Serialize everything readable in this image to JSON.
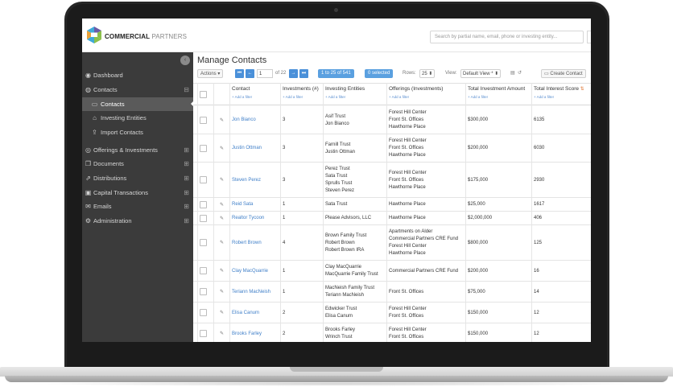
{
  "brand": {
    "name_bold": "COMMERCIAL",
    "name_light": "PARTNERS",
    "colors": [
      "#e8a23a",
      "#3fa9d9",
      "#8cc04b",
      "#6b5ba8"
    ]
  },
  "search": {
    "placeholder": "Search by partial name, email, phone or investing entity..."
  },
  "sidebar": {
    "collapse_icon": "chevron-left-icon",
    "items": [
      {
        "label": "Dashboard",
        "icon": "dashboard-icon",
        "expand": ""
      },
      {
        "label": "Contacts",
        "icon": "contacts-icon",
        "expand": "⊟"
      },
      {
        "label": "Contacts",
        "icon": "card-icon",
        "expand": "",
        "sub": true,
        "active": true
      },
      {
        "label": "Investing Entities",
        "icon": "bank-icon",
        "expand": "",
        "sub": true
      },
      {
        "label": "Import Contacts",
        "icon": "upload-icon",
        "expand": "",
        "sub": true
      },
      {
        "label": "Offerings & Investments",
        "icon": "coins-icon",
        "expand": "⊞"
      },
      {
        "label": "Documents",
        "icon": "documents-icon",
        "expand": "⊞"
      },
      {
        "label": "Distributions",
        "icon": "share-icon",
        "expand": "⊞"
      },
      {
        "label": "Capital Transactions",
        "icon": "money-icon",
        "expand": "⊞"
      },
      {
        "label": "Emails",
        "icon": "mail-icon",
        "expand": "⊞"
      },
      {
        "label": "Administration",
        "icon": "gears-icon",
        "expand": "⊞"
      }
    ]
  },
  "main": {
    "title": "Manage Contacts",
    "toolbar": {
      "actions": "Actions ▾",
      "page": "1",
      "of_pages": "of 22",
      "range": "1 to 25 of 541",
      "selected": "0 selected",
      "rows_label": "Rows:",
      "rows_value": "25 ⬍",
      "view_label": "View:",
      "view_value": "Default View * ⬍",
      "create": "Create Contact"
    },
    "add_filter": "+ Add a filter",
    "columns": [
      "Contact",
      "Investments (#)",
      "Investing Entities",
      "Offerings (Investments)",
      "Total Investment Amount",
      "Total Interest Score"
    ],
    "rows": [
      {
        "contact": "Jon Bianco",
        "investments": "3",
        "entities": [
          "Asif Trust",
          "Jon Bianco"
        ],
        "offerings": [
          "Forest Hill Center",
          "Front St. Offices",
          "Hawthorne Place"
        ],
        "amount": "$300,000",
        "score": "6135"
      },
      {
        "contact": "Justin Ottman",
        "investments": "3",
        "entities": [
          "Farnill Trust",
          "Justin Ottman"
        ],
        "offerings": [
          "Forest Hill Center",
          "Front St. Offices",
          "Hawthorne Place"
        ],
        "amount": "$200,000",
        "score": "6030"
      },
      {
        "contact": "Steven Perez",
        "investments": "3",
        "entities": [
          "Perez Trust",
          "Sata Trust",
          "Sprulls Trust",
          "Steven Perez"
        ],
        "offerings": [
          "Forest Hill Center",
          "Front St. Offices",
          "Hawthorne Place"
        ],
        "amount": "$175,000",
        "score": "2930"
      },
      {
        "contact": "Reid Sata",
        "investments": "1",
        "entities": [
          "Sata Trust"
        ],
        "offerings": [
          "Hawthorne Place"
        ],
        "amount": "$25,000",
        "score": "1617"
      },
      {
        "contact": "Realtor Tycoon",
        "investments": "1",
        "entities": [
          "Please Advisors, LLC"
        ],
        "offerings": [
          "Hawthorne Place"
        ],
        "amount": "$2,000,000",
        "score": "406"
      },
      {
        "contact": "Robert Brown",
        "investments": "4",
        "entities": [
          "Brown Family Trust",
          "Robert Brown",
          "Robert Brown IRA"
        ],
        "offerings": [
          "Apartments on Alder",
          "Commercial Partners CRE Fund",
          "Forest Hill Center",
          "Hawthorne Place"
        ],
        "amount": "$800,000",
        "score": "125"
      },
      {
        "contact": "Clay MacQuarrie",
        "investments": "1",
        "entities": [
          "Clay MacQuarrie",
          "MacQuarrie Family Trust"
        ],
        "offerings": [
          "Commercial Partners CRE Fund"
        ],
        "amount": "$200,000",
        "score": "16"
      },
      {
        "contact": "Teriann MacNeish",
        "investments": "1",
        "entities": [
          "MacNeish Family Trust",
          "Teriann MacNeish"
        ],
        "offerings": [
          "Front St. Offices"
        ],
        "amount": "$75,000",
        "score": "14"
      },
      {
        "contact": "Elisa Canum",
        "investments": "2",
        "entities": [
          "Edwicker Trust",
          "Elisa Canum"
        ],
        "offerings": [
          "Forest Hill Center",
          "Front St. Offices"
        ],
        "amount": "$150,000",
        "score": "12"
      },
      {
        "contact": "Brooks Farley",
        "investments": "2",
        "entities": [
          "Brooks Farley",
          "Wrinch Trust"
        ],
        "offerings": [
          "Forest Hill Center",
          "Front St. Offices"
        ],
        "amount": "$150,000",
        "score": "12"
      }
    ]
  }
}
